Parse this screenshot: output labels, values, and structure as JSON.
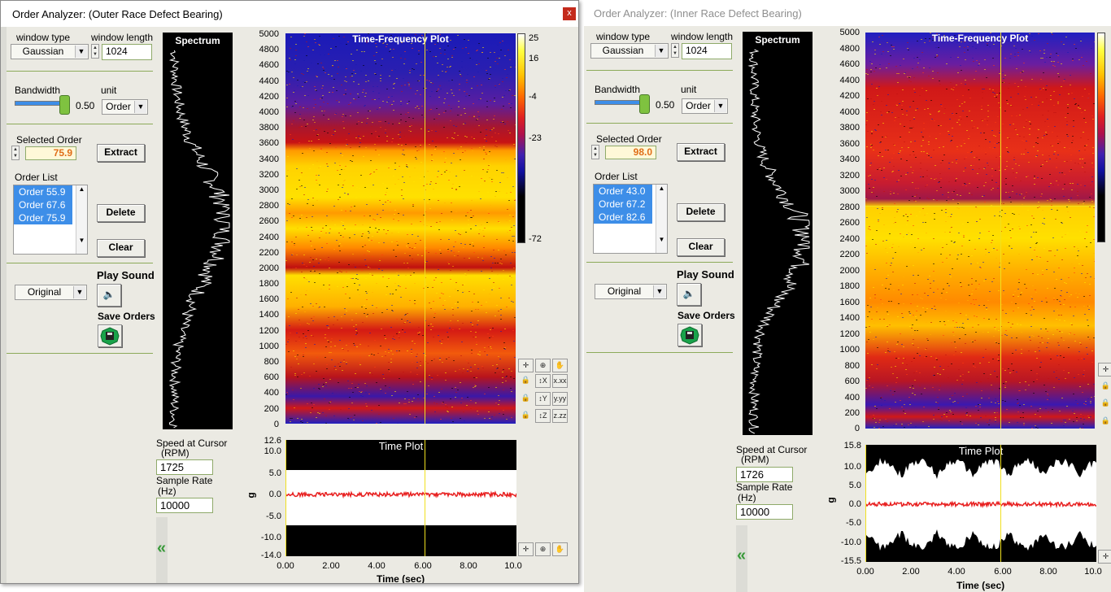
{
  "windows": [
    {
      "title": "Order Analyzer: (Outer Race Defect Bearing)",
      "close_label": "x",
      "window_type_label": "window type",
      "window_type_value": "Gaussian",
      "window_length_label": "window length",
      "window_length_value": "1024",
      "bandwidth_label": "Bandwidth",
      "bandwidth_value": "0.50",
      "bandwidth_level": 0.5,
      "unit_label": "unit",
      "unit_value": "Order",
      "selected_order_label": "Selected Order",
      "selected_order_value": "75.9",
      "extract_label": "Extract",
      "order_list_label": "Order List",
      "orders": [
        "Order 55.9",
        "Order 67.6",
        "Order 75.9"
      ],
      "delete_label": "Delete",
      "clear_label": "Clear",
      "sound_mode": "Original",
      "play_sound_label": "Play Sound",
      "save_orders_label": "Save Orders",
      "speed_label_1": "Speed at Cursor",
      "speed_label_2": "(RPM)",
      "speed_value": "1725",
      "sample_rate_label_1": "Sample Rate",
      "sample_rate_label_2": "(Hz)",
      "sample_rate_value": "10000",
      "spectrum_title": "Spectrum",
      "tf_title": "Time-Frequency Plot",
      "tf_yticks": [
        "5000",
        "4800",
        "4600",
        "4400",
        "4200",
        "4000",
        "3800",
        "3600",
        "3400",
        "3200",
        "3000",
        "2800",
        "2600",
        "2400",
        "2200",
        "2000",
        "1800",
        "1600",
        "1400",
        "1200",
        "1000",
        "800",
        "600",
        "400",
        "200",
        "0"
      ],
      "colorbar_ticks": [
        "25",
        "16",
        "-4",
        "-23",
        "-72"
      ],
      "time_title": "Time Plot",
      "time_ylabel": "g",
      "time_yticks": [
        "12.6",
        "10.0",
        "5.0",
        "0.0",
        "-5.0",
        "-10.0",
        "-14.0"
      ],
      "time_xticks": [
        "0.00",
        "2.00",
        "4.00",
        "6.00",
        "8.00",
        "10.0"
      ],
      "time_xlabel": "Time (sec)"
    },
    {
      "title": "Order Analyzer: (Inner Race Defect Bearing)",
      "window_type_label": "window type",
      "window_type_value": "Gaussian",
      "window_length_label": "window length",
      "window_length_value": "1024",
      "bandwidth_label": "Bandwidth",
      "bandwidth_value": "0.50",
      "bandwidth_level": 0.5,
      "unit_label": "unit",
      "unit_value": "Order",
      "selected_order_label": "Selected Order",
      "selected_order_value": "98.0",
      "extract_label": "Extract",
      "order_list_label": "Order List",
      "orders": [
        "Order 43.0",
        "Order 67.2",
        "Order 82.6"
      ],
      "delete_label": "Delete",
      "clear_label": "Clear",
      "sound_mode": "Original",
      "play_sound_label": "Play Sound",
      "save_orders_label": "Save Orders",
      "speed_label_1": "Speed at Cursor",
      "speed_label_2": "(RPM)",
      "speed_value": "1726",
      "sample_rate_label_1": "Sample Rate",
      "sample_rate_label_2": "(Hz)",
      "sample_rate_value": "10000",
      "spectrum_title": "Spectrum",
      "tf_title": "Time-Frequency Plot",
      "tf_yticks": [
        "5000",
        "4800",
        "4600",
        "4400",
        "4200",
        "4000",
        "3800",
        "3600",
        "3400",
        "3200",
        "3000",
        "2800",
        "2600",
        "2400",
        "2200",
        "2000",
        "1800",
        "1600",
        "1400",
        "1200",
        "1000",
        "800",
        "600",
        "400",
        "200",
        "0"
      ],
      "time_title": "Time Plot",
      "time_ylabel": "g",
      "time_yticks": [
        "15.8",
        "10.0",
        "5.0",
        "0.0",
        "-5.0",
        "-10.0",
        "-15.5"
      ],
      "time_xticks": [
        "0.00",
        "2.00",
        "4.00",
        "6.00",
        "8.00",
        "10.0"
      ],
      "time_xlabel": "Time (sec)"
    }
  ],
  "colors": {
    "window_bg": "#ebeae3",
    "plot_bg": "#000000",
    "separator": "#8caa5a",
    "list_selection": "#3d8ee8",
    "selected_order_text": "#e06e18",
    "cursor_line": "#f0e020",
    "time_signal": "#e82020"
  },
  "icons": {
    "play": "speaker-icon",
    "save": "floppy-disk-icon",
    "collapse": "double-chevron-left-icon",
    "tools": [
      "crosshair-icon",
      "zoom-icon",
      "pan-hand-icon",
      "lock-icon",
      "axis-format-icon"
    ]
  }
}
